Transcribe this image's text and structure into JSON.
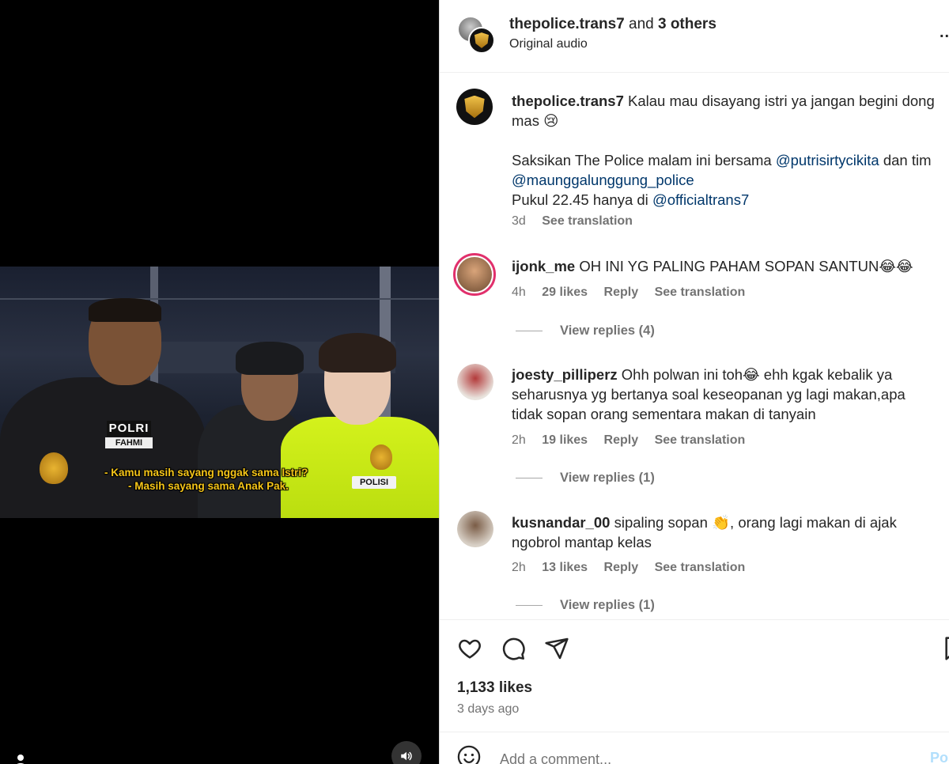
{
  "header": {
    "username": "thepolice.trans7",
    "and_text": "and",
    "others": "3 others",
    "audio": "Original audio",
    "more": "..."
  },
  "caption": {
    "username": "thepolice.trans7",
    "line1": "Kalau mau disayang istri ya jangan begini dong mas 😢",
    "line2_pre": "Saksikan The Police malam ini bersama",
    "mention1": "@putrisirtycikita",
    "line2_mid": "dan tim",
    "mention2": "@maunggalunggung_police",
    "line3_pre": "Pukul 22.45 hanya di",
    "mention3": "@officialtrans7",
    "time": "3d",
    "see_translation": "See translation"
  },
  "comments": [
    {
      "username": "ijonk_me",
      "text": "OH INI YG PALING PAHAM SOPAN SANTUN😂😂",
      "time": "4h",
      "likes": "29 likes",
      "reply": "Reply",
      "see_translation": "See translation",
      "view_replies": "View replies (4)"
    },
    {
      "username": "joesty_pilliperz",
      "text": "Ohh polwan ini toh😂 ehh kgak kebalik ya seharusnya yg bertanya soal keseopanan yg lagi makan,apa tidak sopan orang sementara makan di tanyain",
      "time": "2h",
      "likes": "19 likes",
      "reply": "Reply",
      "see_translation": "See translation",
      "view_replies": "View replies (1)"
    },
    {
      "username": "kusnandar_00",
      "text": "sipaling sopan 👏, orang lagi makan di ajak ngobrol mantap kelas",
      "time": "2h",
      "likes": "13 likes",
      "reply": "Reply",
      "see_translation": "See translation",
      "view_replies": "View replies (1)"
    }
  ],
  "post": {
    "likes": "1,133 likes",
    "posted": "3 days ago"
  },
  "add_comment": {
    "placeholder": "Add a comment...",
    "post_label": "Post"
  },
  "video": {
    "subtitle1": "- Kamu masih sayang nggak sama Istri?",
    "subtitle2": "- Masih sayang sama Anak Pak.",
    "patch_polri": "POLRI",
    "patch_name": "FAHMI",
    "patch_polisi": "POLISI"
  },
  "colors": {
    "link": "#00376b",
    "muted": "#737373",
    "text": "#262626",
    "post_disabled": "#b2dffc"
  }
}
